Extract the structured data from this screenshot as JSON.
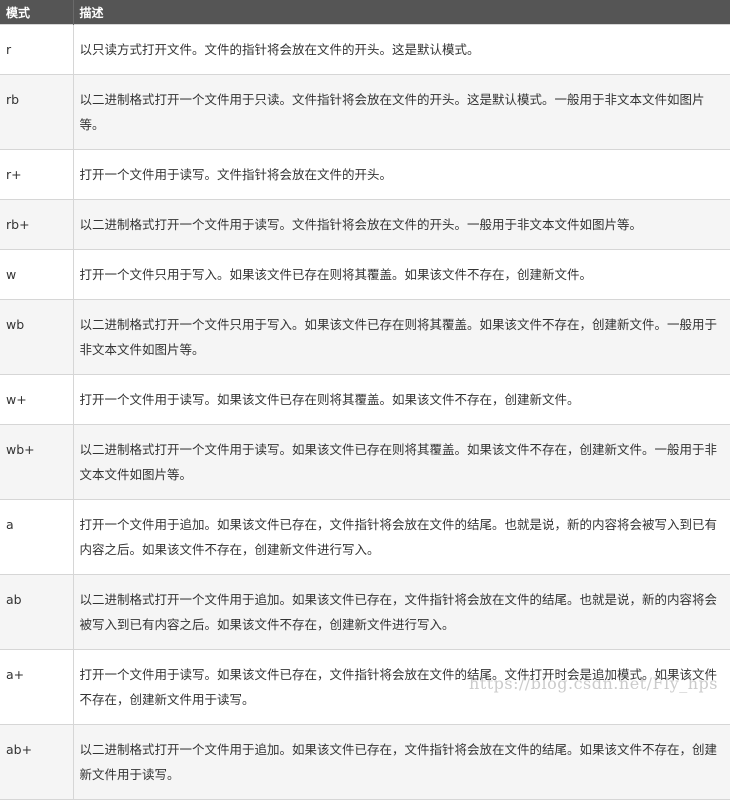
{
  "table": {
    "headers": [
      "模式",
      "描述"
    ],
    "rows": [
      {
        "mode": "r",
        "desc": "以只读方式打开文件。文件的指针将会放在文件的开头。这是默认模式。"
      },
      {
        "mode": "rb",
        "desc": "以二进制格式打开一个文件用于只读。文件指针将会放在文件的开头。这是默认模式。一般用于非文本文件如图片等。"
      },
      {
        "mode": "r+",
        "desc": "打开一个文件用于读写。文件指针将会放在文件的开头。"
      },
      {
        "mode": "rb+",
        "desc": "以二进制格式打开一个文件用于读写。文件指针将会放在文件的开头。一般用于非文本文件如图片等。"
      },
      {
        "mode": "w",
        "desc": "打开一个文件只用于写入。如果该文件已存在则将其覆盖。如果该文件不存在，创建新文件。"
      },
      {
        "mode": "wb",
        "desc": "以二进制格式打开一个文件只用于写入。如果该文件已存在则将其覆盖。如果该文件不存在，创建新文件。一般用于非文本文件如图片等。"
      },
      {
        "mode": "w+",
        "desc": "打开一个文件用于读写。如果该文件已存在则将其覆盖。如果该文件不存在，创建新文件。"
      },
      {
        "mode": "wb+",
        "desc": "以二进制格式打开一个文件用于读写。如果该文件已存在则将其覆盖。如果该文件不存在，创建新文件。一般用于非文本文件如图片等。"
      },
      {
        "mode": "a",
        "desc": "打开一个文件用于追加。如果该文件已存在，文件指针将会放在文件的结尾。也就是说，新的内容将会被写入到已有内容之后。如果该文件不存在，创建新文件进行写入。"
      },
      {
        "mode": "ab",
        "desc": "以二进制格式打开一个文件用于追加。如果该文件已存在，文件指针将会放在文件的结尾。也就是说，新的内容将会被写入到已有内容之后。如果该文件不存在，创建新文件进行写入。"
      },
      {
        "mode": "a+",
        "desc": "打开一个文件用于读写。如果该文件已存在，文件指针将会放在文件的结尾。文件打开时会是追加模式。如果该文件不存在，创建新文件用于读写。"
      },
      {
        "mode": "ab+",
        "desc": "以二进制格式打开一个文件用于追加。如果该文件已存在，文件指针将会放在文件的结尾。如果该文件不存在，创建新文件用于读写。"
      }
    ]
  },
  "watermark": "https://blog.csdn.net/Fly_hps"
}
